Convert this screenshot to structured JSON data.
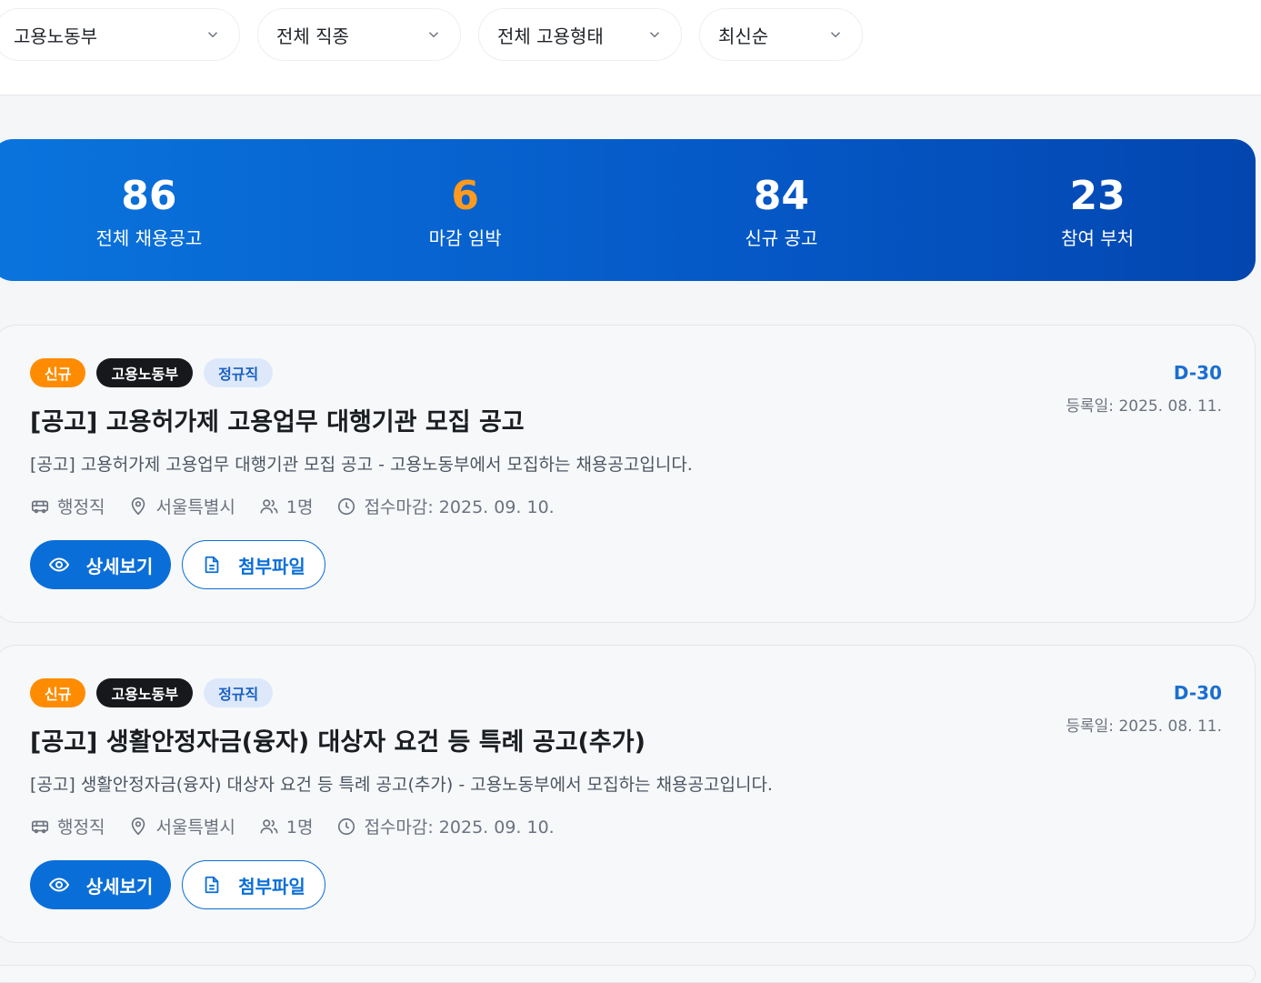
{
  "filters": [
    {
      "value": "고용노동부"
    },
    {
      "value": "전체 직종"
    },
    {
      "value": "전체 고용형태"
    },
    {
      "value": "최신순"
    }
  ],
  "stats": [
    {
      "value": "86",
      "label": "전체 채용공고"
    },
    {
      "value": "6",
      "label": "마감 임박"
    },
    {
      "value": "84",
      "label": "신규 공고"
    },
    {
      "value": "23",
      "label": "참여 부처"
    }
  ],
  "colors": {
    "accent": "#0a6ed8",
    "new_badge": "#ff8c00",
    "urgent_stat": "#ff9a1f"
  },
  "jobs": [
    {
      "badge_new": "신규",
      "badge_dept": "고용노동부",
      "badge_type": "정규직",
      "dday": "D-30",
      "reg_date": "등록일: 2025. 08. 11.",
      "title": "[공고] 고용허가제 고용업무 대행기관 모집 공고",
      "description": "[공고] 고용허가제 고용업무 대행기관 모집 공고 - 고용노동부에서 모집하는 채용공고입니다.",
      "job_category": "행정직",
      "location": "서울특별시",
      "headcount": "1명",
      "deadline": "접수마감: 2025. 09. 10.",
      "detail_label": "상세보기",
      "attach_label": "첨부파일"
    },
    {
      "badge_new": "신규",
      "badge_dept": "고용노동부",
      "badge_type": "정규직",
      "dday": "D-30",
      "reg_date": "등록일: 2025. 08. 11.",
      "title": "[공고] 생활안정자금(융자) 대상자 요건 등 특례 공고(추가)",
      "description": "[공고] 생활안정자금(융자) 대상자 요건 등 특례 공고(추가) - 고용노동부에서 모집하는 채용공고입니다.",
      "job_category": "행정직",
      "location": "서울특별시",
      "headcount": "1명",
      "deadline": "접수마감: 2025. 09. 10.",
      "detail_label": "상세보기",
      "attach_label": "첨부파일"
    }
  ]
}
